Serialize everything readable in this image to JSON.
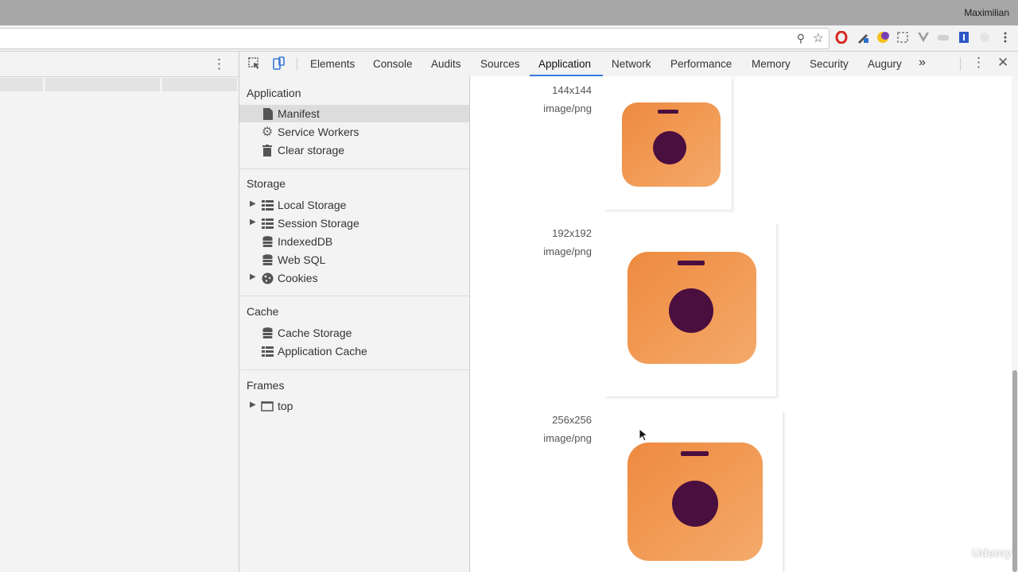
{
  "browser": {
    "profile_name": "Maximilian",
    "extension_icons": [
      "opera-icon",
      "pen-tool-icon",
      "moon-icon",
      "crop-icon",
      "vue-icon",
      "mask-icon",
      "shield-icon",
      "circle-icon",
      "more-vertical-icon"
    ]
  },
  "devtools": {
    "tabs": [
      "Elements",
      "Console",
      "Audits",
      "Sources",
      "Application",
      "Network",
      "Performance",
      "Memory",
      "Security",
      "Augury"
    ],
    "active_tab": "Application",
    "overflow_label": "»",
    "sidebar": {
      "application": {
        "title": "Application",
        "items": [
          {
            "label": "Manifest",
            "icon": "document-icon",
            "selected": true
          },
          {
            "label": "Service Workers",
            "icon": "gear-icon"
          },
          {
            "label": "Clear storage",
            "icon": "trash-icon"
          }
        ]
      },
      "storage": {
        "title": "Storage",
        "items": [
          {
            "label": "Local Storage",
            "icon": "grid-icon",
            "expandable": true
          },
          {
            "label": "Session Storage",
            "icon": "grid-icon",
            "expandable": true
          },
          {
            "label": "IndexedDB",
            "icon": "database-icon"
          },
          {
            "label": "Web SQL",
            "icon": "database-icon"
          },
          {
            "label": "Cookies",
            "icon": "cookie-icon",
            "expandable": true
          }
        ]
      },
      "cache": {
        "title": "Cache",
        "items": [
          {
            "label": "Cache Storage",
            "icon": "database-icon"
          },
          {
            "label": "Application Cache",
            "icon": "grid-icon"
          }
        ]
      },
      "frames": {
        "title": "Frames",
        "items": [
          {
            "label": "top",
            "icon": "frame-icon",
            "expandable": true
          }
        ]
      }
    },
    "manifest_icons": [
      {
        "size": "144x144",
        "type": "image/png"
      },
      {
        "size": "192x192",
        "type": "image/png"
      },
      {
        "size": "256x256",
        "type": "image/png"
      }
    ],
    "colors": {
      "camera_orange": "#f19a55",
      "camera_lens": "#4a0f3f",
      "accent_blue": "#3879d9"
    }
  },
  "watermark": "Udemy"
}
